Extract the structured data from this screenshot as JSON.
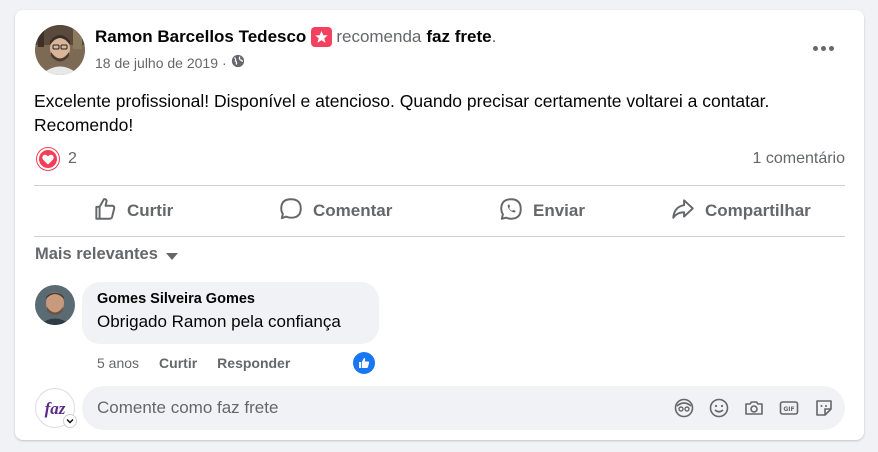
{
  "post": {
    "author": "Ramon Barcellos Tedesco",
    "recommends_text": "recomenda",
    "page_name": "faz frete",
    "period": ".",
    "date": "18 de julho de 2019",
    "date_separator": "·",
    "audience_icon": "globe-icon",
    "text": "Excelente profissional! Disponível e atencioso. Quando precisar certamente voltarei a contatar. Recomendo!",
    "reaction_icon": "love-reaction-icon",
    "reaction_count": "2",
    "comment_count": "1 comentário"
  },
  "actions": {
    "like": "Curtir",
    "comment": "Comentar",
    "send": "Enviar",
    "share": "Compartilhar"
  },
  "comments": {
    "sort_label": "Mais relevantes",
    "items": [
      {
        "author": "Gomes Silveira Gomes",
        "text": "Obrigado Ramon pela confiança",
        "age": "5 anos",
        "like": "Curtir",
        "reply": "Responder",
        "reaction_icon": "like-reaction-icon"
      }
    ]
  },
  "composer": {
    "placeholder": "Comente como faz frete",
    "avatar_logo": "faz",
    "icons": [
      "avatar-sticker-icon",
      "emoji-icon",
      "camera-icon",
      "gif-icon",
      "sticker-icon"
    ]
  },
  "colors": {
    "text_primary": "#050505",
    "text_secondary": "#65676b",
    "love": "#f33e58",
    "recommend": "#f3425f",
    "like": "#1877f2",
    "background": "#f0f2f5",
    "logo_purple": "#5b2a86"
  }
}
